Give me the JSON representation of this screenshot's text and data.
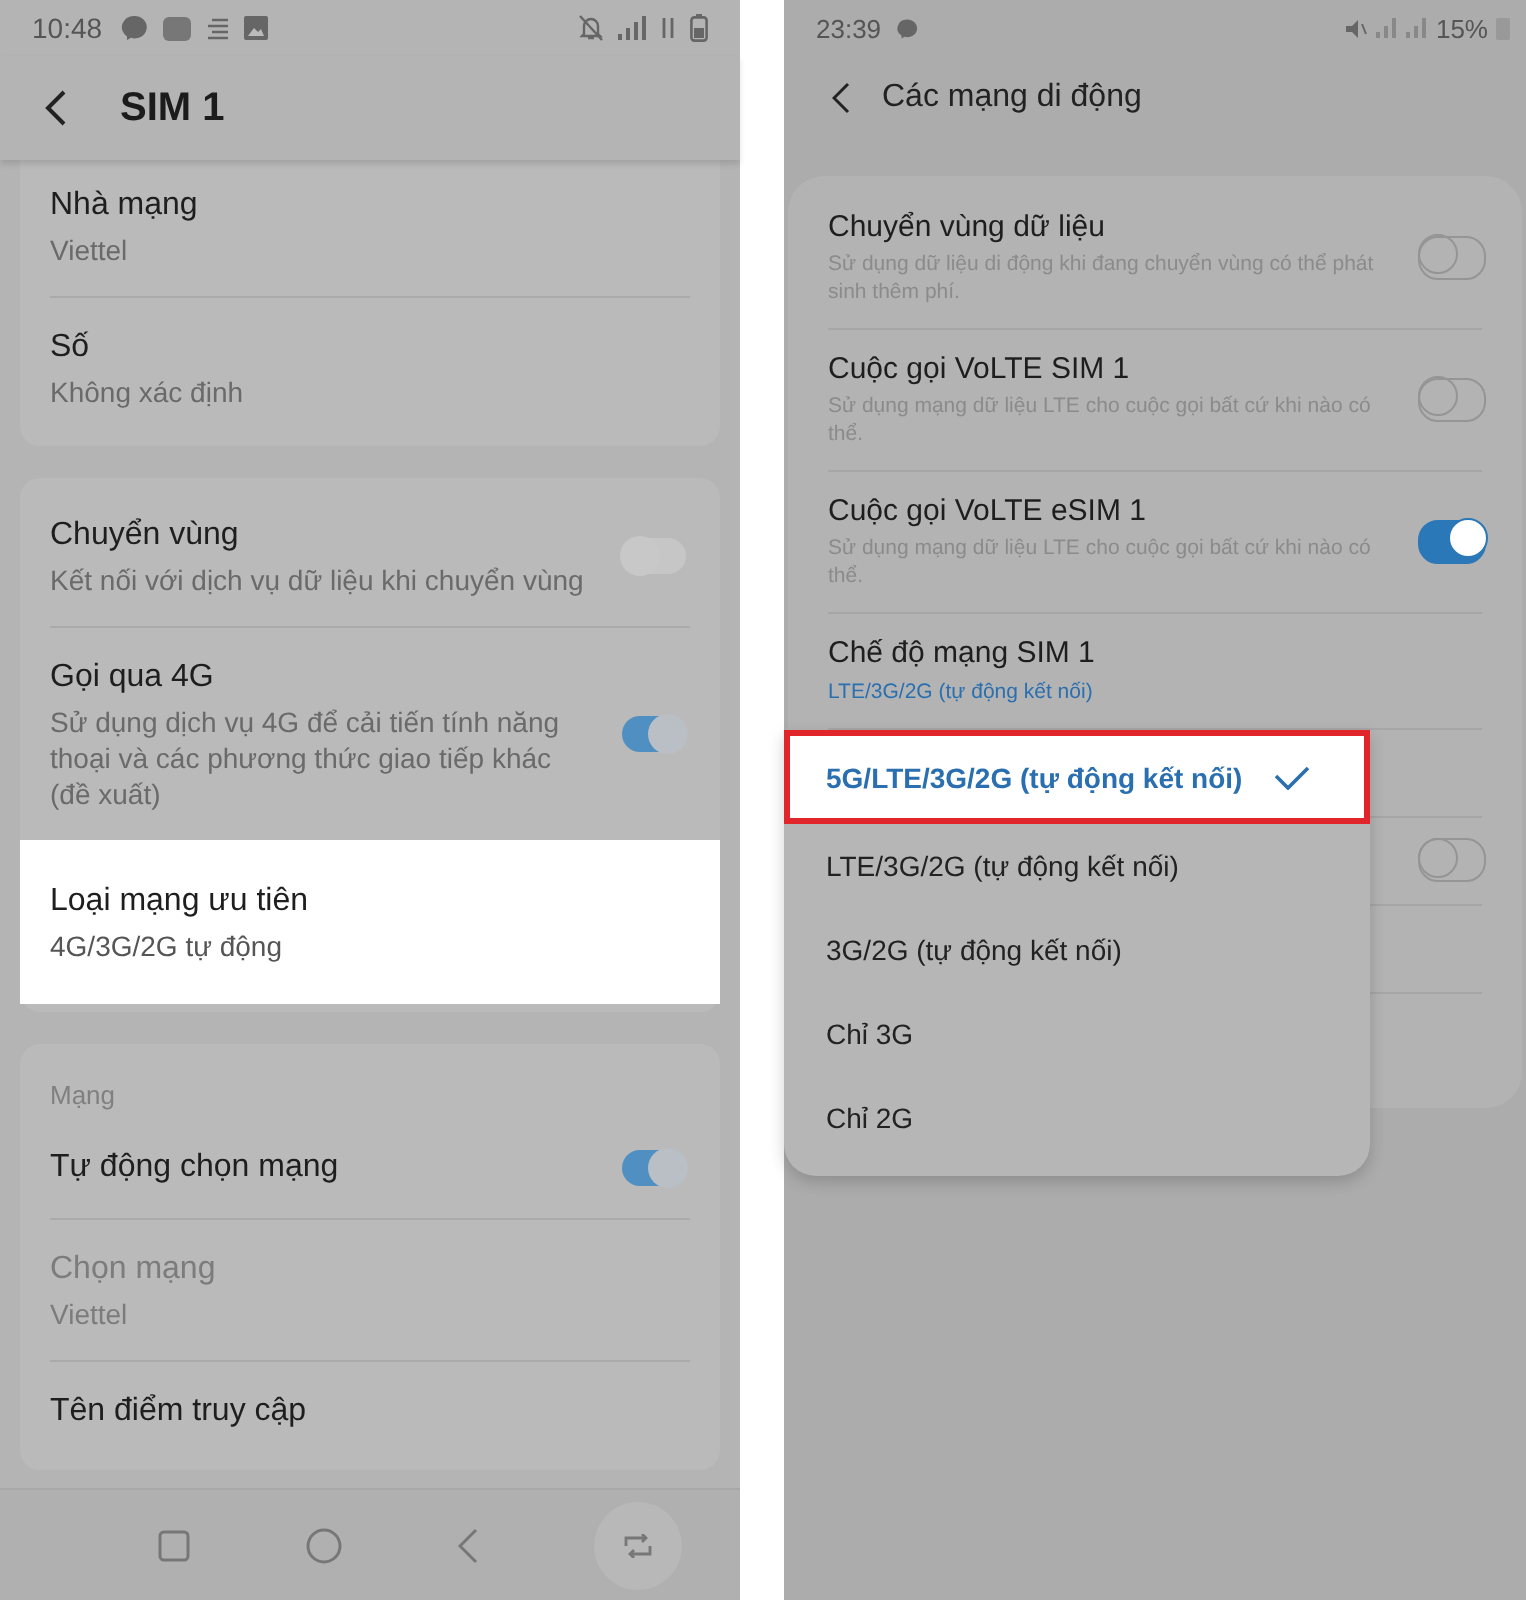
{
  "left_screen": {
    "status_bar": {
      "time": "10:48"
    },
    "title": "SIM 1",
    "cards": [
      {
        "rows": [
          {
            "kind": "info",
            "title": "Nhà mạng",
            "subtitle": "Viettel",
            "disabled": false,
            "highlighted": false
          },
          {
            "kind": "info",
            "title": "Số",
            "subtitle": "Không xác định",
            "disabled": false,
            "highlighted": false
          }
        ]
      },
      {
        "rows": [
          {
            "kind": "toggle",
            "title": "Chuyển vùng",
            "subtitle": "Kết nối với dịch vụ dữ liệu khi chuyển vùng",
            "on": false,
            "disabled": false,
            "highlighted": false
          },
          {
            "kind": "toggle",
            "title": "Gọi qua 4G",
            "subtitle": "Sử dụng dịch vụ 4G để cải tiến tính năng thoại và các phương thức giao tiếp khác (đề xuất)",
            "on": true,
            "disabled": false,
            "highlighted": false
          },
          {
            "kind": "info",
            "title": "Loại mạng ưu tiên",
            "subtitle": "4G/3G/2G tự động",
            "disabled": false,
            "highlighted": true
          }
        ]
      },
      {
        "header": "Mạng",
        "rows": [
          {
            "kind": "toggle",
            "title": "Tự động chọn mạng",
            "on": true,
            "disabled": false,
            "highlighted": false
          },
          {
            "kind": "info",
            "title": "Chọn mạng",
            "subtitle": "Viettel",
            "disabled": true,
            "highlighted": false
          },
          {
            "kind": "info",
            "title": "Tên điểm truy cập",
            "disabled": false,
            "highlighted": false
          }
        ]
      }
    ]
  },
  "right_screen": {
    "status_bar": {
      "time": "23:39",
      "battery": "15%"
    },
    "title": "Các mạng di động",
    "rows": [
      {
        "kind": "toggle",
        "title": "Chuyển vùng dữ liệu",
        "subtitle": "Sử dụng dữ liệu di động khi đang chuyển vùng có thể phát sinh thêm phí.",
        "on": false
      },
      {
        "kind": "toggle",
        "title": "Cuộc gọi VoLTE SIM 1",
        "subtitle": "Sử dụng mạng dữ liệu LTE cho cuộc gọi bất cứ khi nào có thể.",
        "on": false
      },
      {
        "kind": "toggle",
        "title": "Cuộc gọi VoLTE eSIM 1",
        "subtitle": "Sử dụng mạng dữ liệu LTE cho cuộc gọi bất cứ khi nào có thể.",
        "on": true
      },
      {
        "kind": "value",
        "title": "Chế độ mạng SIM 1",
        "value": "LTE/3G/2G (tự động kết nối)"
      },
      {
        "kind": "covered"
      },
      {
        "kind": "toggle",
        "on": false
      },
      {
        "kind": "covered"
      },
      {
        "kind": "covered"
      }
    ],
    "dropdown": {
      "options": [
        {
          "label": "5G/LTE/3G/2G (tự động kết nối)",
          "selected": true,
          "annotated": true
        },
        {
          "label": "LTE/3G/2G (tự động kết nối)",
          "selected": false,
          "annotated": false
        },
        {
          "label": "3G/2G (tự động kết nối)",
          "selected": false,
          "annotated": false
        },
        {
          "label": "Chỉ 3G",
          "selected": false,
          "annotated": false
        },
        {
          "label": "Chỉ 2G",
          "selected": false,
          "annotated": false
        }
      ]
    }
  }
}
